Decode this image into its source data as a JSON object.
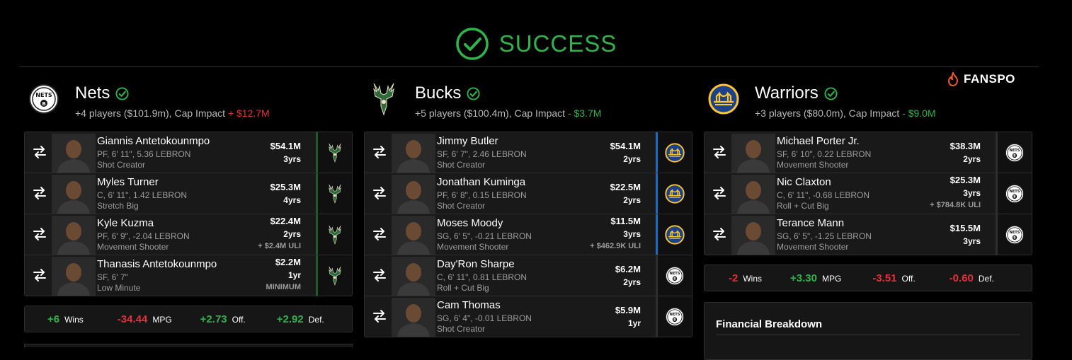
{
  "banner": {
    "text": "SUCCESS"
  },
  "brand": {
    "name": "FANSPO"
  },
  "teams": [
    {
      "name": "Nets",
      "summary": "+4 players ($101.9m), Cap Impact",
      "impact": "+ $12.7M",
      "players": [
        {
          "name": "Giannis Antetokounmpo",
          "pos": "PF, 6' 11\", 5.36 LEBRON",
          "role": "Shot Creator",
          "salary": "$54.1M",
          "years": "3yrs",
          "extra": "",
          "dest": "Bucks"
        },
        {
          "name": "Myles Turner",
          "pos": "C, 6' 11\", 1.42 LEBRON",
          "role": "Stretch Big",
          "salary": "$25.3M",
          "years": "4yrs",
          "extra": "",
          "dest": "Bucks"
        },
        {
          "name": "Kyle Kuzma",
          "pos": "PF, 6' 9\", -2.04 LEBRON",
          "role": "Movement Shooter",
          "salary": "$22.4M",
          "years": "2yrs",
          "extra": "+ $2.4M ULI",
          "dest": "Bucks"
        },
        {
          "name": "Thanasis Antetokounmpo",
          "pos": "SF, 6' 7\"",
          "role": "Low Minute",
          "salary": "$2.2M",
          "years": "1yr",
          "extra": "MINIMUM",
          "dest": "Bucks"
        }
      ],
      "stats": {
        "wins": "+6",
        "wins_label": "Wins",
        "mpg": "-34.44",
        "mpg_label": "MPG",
        "off": "+2.73",
        "off_label": "Off.",
        "def": "+2.92",
        "def_label": "Def."
      }
    },
    {
      "name": "Bucks",
      "summary": "+5 players ($100.4m), Cap Impact",
      "impact": "- $3.7M",
      "players": [
        {
          "name": "Jimmy Butler",
          "pos": "SF, 6' 7\", 2.46 LEBRON",
          "role": "Shot Creator",
          "salary": "$54.1M",
          "years": "2yrs",
          "extra": "",
          "dest": "Warriors"
        },
        {
          "name": "Jonathan Kuminga",
          "pos": "PF, 6' 8\", 0.15 LEBRON",
          "role": "Shot Creator",
          "salary": "$22.5M",
          "years": "2yrs",
          "extra": "",
          "dest": "Warriors"
        },
        {
          "name": "Moses Moody",
          "pos": "SG, 6' 5\", -0.21 LEBRON",
          "role": "Movement Shooter",
          "salary": "$11.5M",
          "years": "3yrs",
          "extra": "+ $462.9K ULI",
          "dest": "Warriors"
        },
        {
          "name": "Day'Ron Sharpe",
          "pos": "C, 6' 11\", 0.81 LEBRON",
          "role": "Roll + Cut Big",
          "salary": "$6.2M",
          "years": "2yrs",
          "extra": "",
          "dest": "Nets"
        },
        {
          "name": "Cam Thomas",
          "pos": "SG, 6' 4\", -0.01 LEBRON",
          "role": "Shot Creator",
          "salary": "$5.9M",
          "years": "1yr",
          "extra": "",
          "dest": "Nets"
        }
      ]
    },
    {
      "name": "Warriors",
      "summary": "+3 players ($80.0m), Cap Impact",
      "impact": "- $9.0M",
      "players": [
        {
          "name": "Michael Porter Jr.",
          "pos": "SF, 6' 10\", 0.22 LEBRON",
          "role": "Movement Shooter",
          "salary": "$38.3M",
          "years": "2yrs",
          "extra": "",
          "dest": "Nets"
        },
        {
          "name": "Nic Claxton",
          "pos": "C, 6' 11\", -0.68 LEBRON",
          "role": "Roll + Cut Big",
          "salary": "$25.3M",
          "years": "3yrs",
          "extra": "+ $784.8K ULI",
          "dest": "Nets"
        },
        {
          "name": "Terance Mann",
          "pos": "SG, 6' 5\", -1.25 LEBRON",
          "role": "Movement Shooter",
          "salary": "$15.5M",
          "years": "3yrs",
          "extra": "",
          "dest": "Nets"
        }
      ],
      "stats": {
        "wins": "-2",
        "wins_label": "Wins",
        "mpg": "+3.30",
        "mpg_label": "MPG",
        "off": "-3.51",
        "off_label": "Off.",
        "def": "-0.60",
        "def_label": "Def."
      }
    }
  ],
  "financial": {
    "title": "Financial Breakdown"
  },
  "colors": {
    "success": "#2fb34a",
    "negative": "#e2313a",
    "bucks": "#00471b",
    "warriors": "#1d428a",
    "warriors_gold": "#ffc72c",
    "nets": "#000000"
  },
  "icons": [
    "check-circle-icon",
    "check-icon",
    "swap-icon",
    "flame-icon",
    "nets-logo",
    "bucks-logo",
    "warriors-logo"
  ]
}
